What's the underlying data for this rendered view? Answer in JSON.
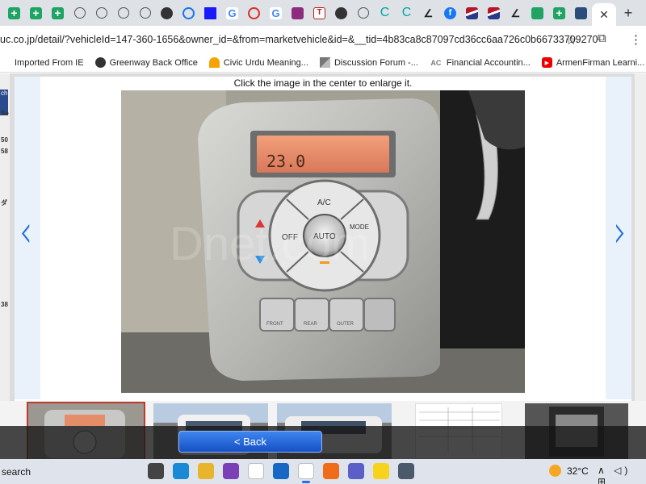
{
  "browser": {
    "tabs": [
      {
        "icon": "green-plus-icon",
        "cls": "green"
      },
      {
        "icon": "green-plus-icon",
        "cls": "green"
      },
      {
        "icon": "green-plus-icon",
        "cls": "green"
      },
      {
        "icon": "phone-icon",
        "cls": "outline"
      },
      {
        "icon": "eye-icon",
        "cls": "outline"
      },
      {
        "icon": "eye-icon",
        "cls": "outline"
      },
      {
        "icon": "eye-icon",
        "cls": "outline"
      },
      {
        "icon": "globe-icon",
        "cls": "dark"
      },
      {
        "icon": "ring-logo-icon",
        "cls": "ring"
      },
      {
        "icon": "blue-square-icon",
        "cls": "blue"
      },
      {
        "icon": "google-icon",
        "cls": "g"
      },
      {
        "icon": "red-circle-icon",
        "cls": "red-ring"
      },
      {
        "icon": "google-icon",
        "cls": "g"
      },
      {
        "icon": "purple-square-icon",
        "cls": "purple"
      },
      {
        "icon": "t-logo-icon",
        "cls": "T"
      },
      {
        "icon": "dark-circle-icon",
        "cls": "dark"
      },
      {
        "icon": "dots-icon",
        "cls": "outline"
      },
      {
        "icon": "c-logo-icon",
        "cls": "C"
      },
      {
        "icon": "c-logo-icon",
        "cls": "C"
      },
      {
        "icon": "chart-icon",
        "cls": "mono"
      },
      {
        "icon": "facebook-icon",
        "cls": "fb"
      },
      {
        "icon": "flag-stripe-icon",
        "cls": "stripe"
      },
      {
        "icon": "flag-stripe-icon",
        "cls": "stripe"
      },
      {
        "icon": "dash-icon",
        "cls": "mono"
      },
      {
        "icon": "sheet-icon",
        "cls": "sheet"
      },
      {
        "icon": "green-plus-icon",
        "cls": "green"
      },
      {
        "icon": "car-site-icon",
        "cls": "car"
      }
    ],
    "active_tab_close": "✕",
    "new_tab": "+",
    "url": "uc.co.jp/detail/?vehicleId=147-360-1656&owner_id=&from=marketvehicle&id=&__tid=4b83ca8c87097cd36cc6aa726c0b66733709270",
    "star": "☆",
    "extensions": "⧉",
    "menu": "⋮",
    "bookmarks": [
      {
        "label": "Imported From IE",
        "icon": "folder-icon",
        "cls": ""
      },
      {
        "label": "Greenway Back Office",
        "icon": "greenway-icon",
        "cls": "gw"
      },
      {
        "label": "Civic Urdu Meaning...",
        "icon": "rainbow-icon",
        "cls": "cu"
      },
      {
        "label": "Discussion Forum -...",
        "icon": "forum-icon",
        "cls": "df"
      },
      {
        "label": "Financial Accountin...",
        "icon": "ac-logo-icon",
        "cls": "ac"
      },
      {
        "label": "ArmenFirman Learni...",
        "icon": "youtube-icon",
        "cls": "yt"
      }
    ],
    "bookmark_glyphs": [
      "",
      "",
      "",
      "",
      "AC",
      "▶"
    ]
  },
  "page": {
    "hint": "Click the image in the center to enlarge it.",
    "prev_arrow": "‹",
    "next_arrow": "›",
    "photo": {
      "display_temp": "23.0",
      "ac_label": "A/C",
      "off_label": "OFF",
      "auto_label": "AUTO",
      "mode_label": "MODE",
      "front_label": "FRONT",
      "rear_label": "REAR",
      "outer_label": "OUTER",
      "watermark": "Dnet.com"
    },
    "back_button": "< Back",
    "left_edge_marks": [
      "ch",
      "Se",
      "50",
      "58",
      "ダ",
      "38"
    ]
  },
  "taskbar": {
    "search": "search",
    "temperature": "32°C",
    "tray": "∧ ◁) ⊞",
    "apps": [
      {
        "icon": "task-view-icon",
        "color": "#444"
      },
      {
        "icon": "edge-icon",
        "color": "#1b8ad6"
      },
      {
        "icon": "file-explorer-icon",
        "color": "#e8b42b"
      },
      {
        "icon": "onenote-icon",
        "color": "#7b3fb6"
      },
      {
        "icon": "java-icon",
        "color": "#ffffff"
      },
      {
        "icon": "outlook-icon",
        "color": "#1668c4"
      },
      {
        "icon": "chrome-icon",
        "color": "#ffffff"
      },
      {
        "icon": "firefox-icon",
        "color": "#f06b1a"
      },
      {
        "icon": "teams-icon",
        "color": "#5b5fc7"
      },
      {
        "icon": "sticky-notes-icon",
        "color": "#f7d31e"
      },
      {
        "icon": "calculator-icon",
        "color": "#4a5a6a"
      }
    ]
  }
}
